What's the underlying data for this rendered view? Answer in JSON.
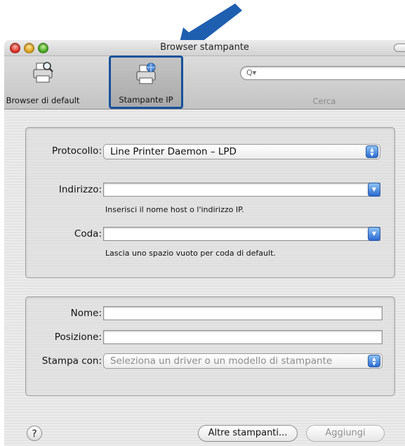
{
  "window": {
    "title": "Browser stampante"
  },
  "toolbar": {
    "default_browser_label": "Browser di default",
    "ip_printer_label": "Stampante IP",
    "search_label": "Cerca",
    "search_value": ""
  },
  "connection": {
    "protocol_label": "Protocollo:",
    "protocol_value": "Line Printer Daemon – LPD",
    "address_label": "Indirizzo:",
    "address_value": "",
    "address_hint": "Inserisci il nome host o l'indirizzo IP.",
    "queue_label": "Coda:",
    "queue_value": "",
    "queue_hint": "Lascia uno spazio vuoto per coda di default."
  },
  "details": {
    "name_label": "Nome:",
    "name_value": "",
    "location_label": "Posizione:",
    "location_value": "",
    "print_using_label": "Stampa con:",
    "print_using_value": "Seleziona un driver o un modello di stampante"
  },
  "footer": {
    "help_label": "?",
    "more_printers_label": "Altre stampanti...",
    "add_label": "Aggiungi"
  },
  "colors": {
    "highlight_border": "#17519b",
    "arrow": "#1f5fb0",
    "popup_arrow": "#2a6ad0"
  }
}
